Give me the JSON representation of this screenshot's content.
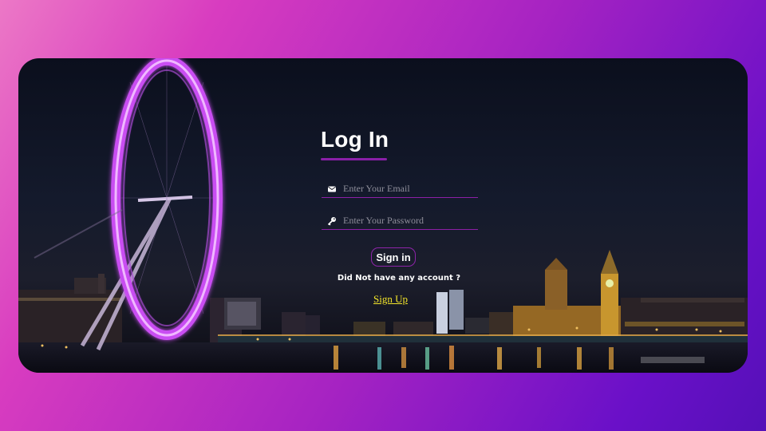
{
  "login": {
    "title": "Log In",
    "email_placeholder": "Enter Your Email",
    "password_placeholder": "Enter Your Password",
    "signin_label": "Sign in",
    "no_account_text": "Did Not have any account ?",
    "signup_label": "Sign Up"
  },
  "icons": {
    "email": "envelope-icon",
    "password": "key-icon"
  },
  "colors": {
    "accent": "#8a1fa8",
    "link": "#f2e42a",
    "wheel_glow": "#d65cff"
  }
}
